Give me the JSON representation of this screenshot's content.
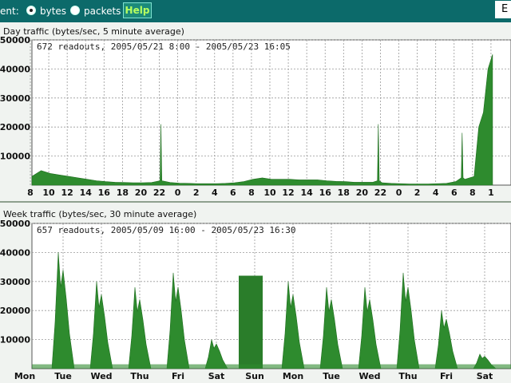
{
  "toolbar": {
    "partial_label": "ent:",
    "bytes_label": "bytes",
    "packets_label": "packets",
    "help_label": "Help",
    "corner_glyph": "E",
    "accent": "#0c6a6a"
  },
  "chart_data": [
    {
      "type": "area",
      "title": "Day traffic (bytes/sec, 5 minute average)",
      "subtitle": "672 readouts, 2005/05/21 8:00 - 2005/05/23 16:05",
      "ylim": [
        0,
        50000
      ],
      "yticks": [
        10000,
        20000,
        30000,
        40000,
        50000
      ],
      "xticks": [
        "8",
        "10",
        "12",
        "14",
        "16",
        "18",
        "20",
        "22",
        "0",
        "2",
        "4",
        "6",
        "8",
        "10",
        "12",
        "14",
        "16",
        "18",
        "20",
        "22",
        "0",
        "2",
        "4",
        "6",
        "8",
        "1"
      ],
      "x_start_hour": 8,
      "x_end_hour": 60,
      "grid": true,
      "color": "#2e8b2e",
      "series": [
        {
          "x": [
            8,
            9,
            10,
            11,
            12,
            13,
            14,
            15,
            16,
            17,
            18,
            19,
            20,
            21,
            21.9,
            22,
            22.1,
            23,
            0,
            1,
            2,
            3,
            4,
            5,
            6,
            7,
            8,
            9,
            10,
            11,
            12,
            13,
            14,
            15,
            16,
            17,
            18,
            19,
            20,
            21,
            21.5,
            21.6,
            21.7,
            22,
            23,
            0,
            1,
            2,
            3,
            4,
            5,
            6,
            6.6,
            6.7,
            6.8,
            7,
            7.5,
            8,
            8.5,
            9,
            9.5,
            10
          ],
          "y": [
            3000,
            5000,
            4000,
            3500,
            3000,
            2500,
            2000,
            1500,
            1200,
            1000,
            900,
            800,
            800,
            900,
            1500,
            21000,
            1500,
            900,
            700,
            600,
            500,
            500,
            500,
            600,
            800,
            1200,
            2000,
            2500,
            2000,
            2000,
            2000,
            1800,
            1800,
            1800,
            1500,
            1300,
            1200,
            1000,
            1000,
            1000,
            1500,
            21000,
            1500,
            800,
            600,
            500,
            400,
            400,
            400,
            500,
            600,
            1200,
            2500,
            18000,
            2500,
            2000,
            2500,
            3000,
            20000,
            25000,
            40000,
            45000
          ]
        }
      ]
    },
    {
      "type": "area",
      "title": "Week traffic (bytes/sec, 30 minute average)",
      "subtitle": "657 readouts, 2005/05/09 16:00 - 2005/05/23 16:30",
      "ylim": [
        0,
        50000
      ],
      "yticks": [
        10000,
        20000,
        30000,
        40000,
        50000
      ],
      "xticks": [
        "Mon",
        "Tue",
        "Wed",
        "Thu",
        "Fri",
        "Sat",
        "Sun",
        "Mon",
        "Tue",
        "Wed",
        "Thu",
        "Fri",
        "Sat"
      ],
      "grid": true,
      "color": "#2e8b2e",
      "series": [
        {
          "day_peaks": [
            40000,
            30000,
            28000,
            33000,
            10000,
            32000,
            30000,
            28000,
            28000,
            33000,
            20000,
            5000
          ],
          "flat_day_index": 5
        }
      ]
    }
  ]
}
